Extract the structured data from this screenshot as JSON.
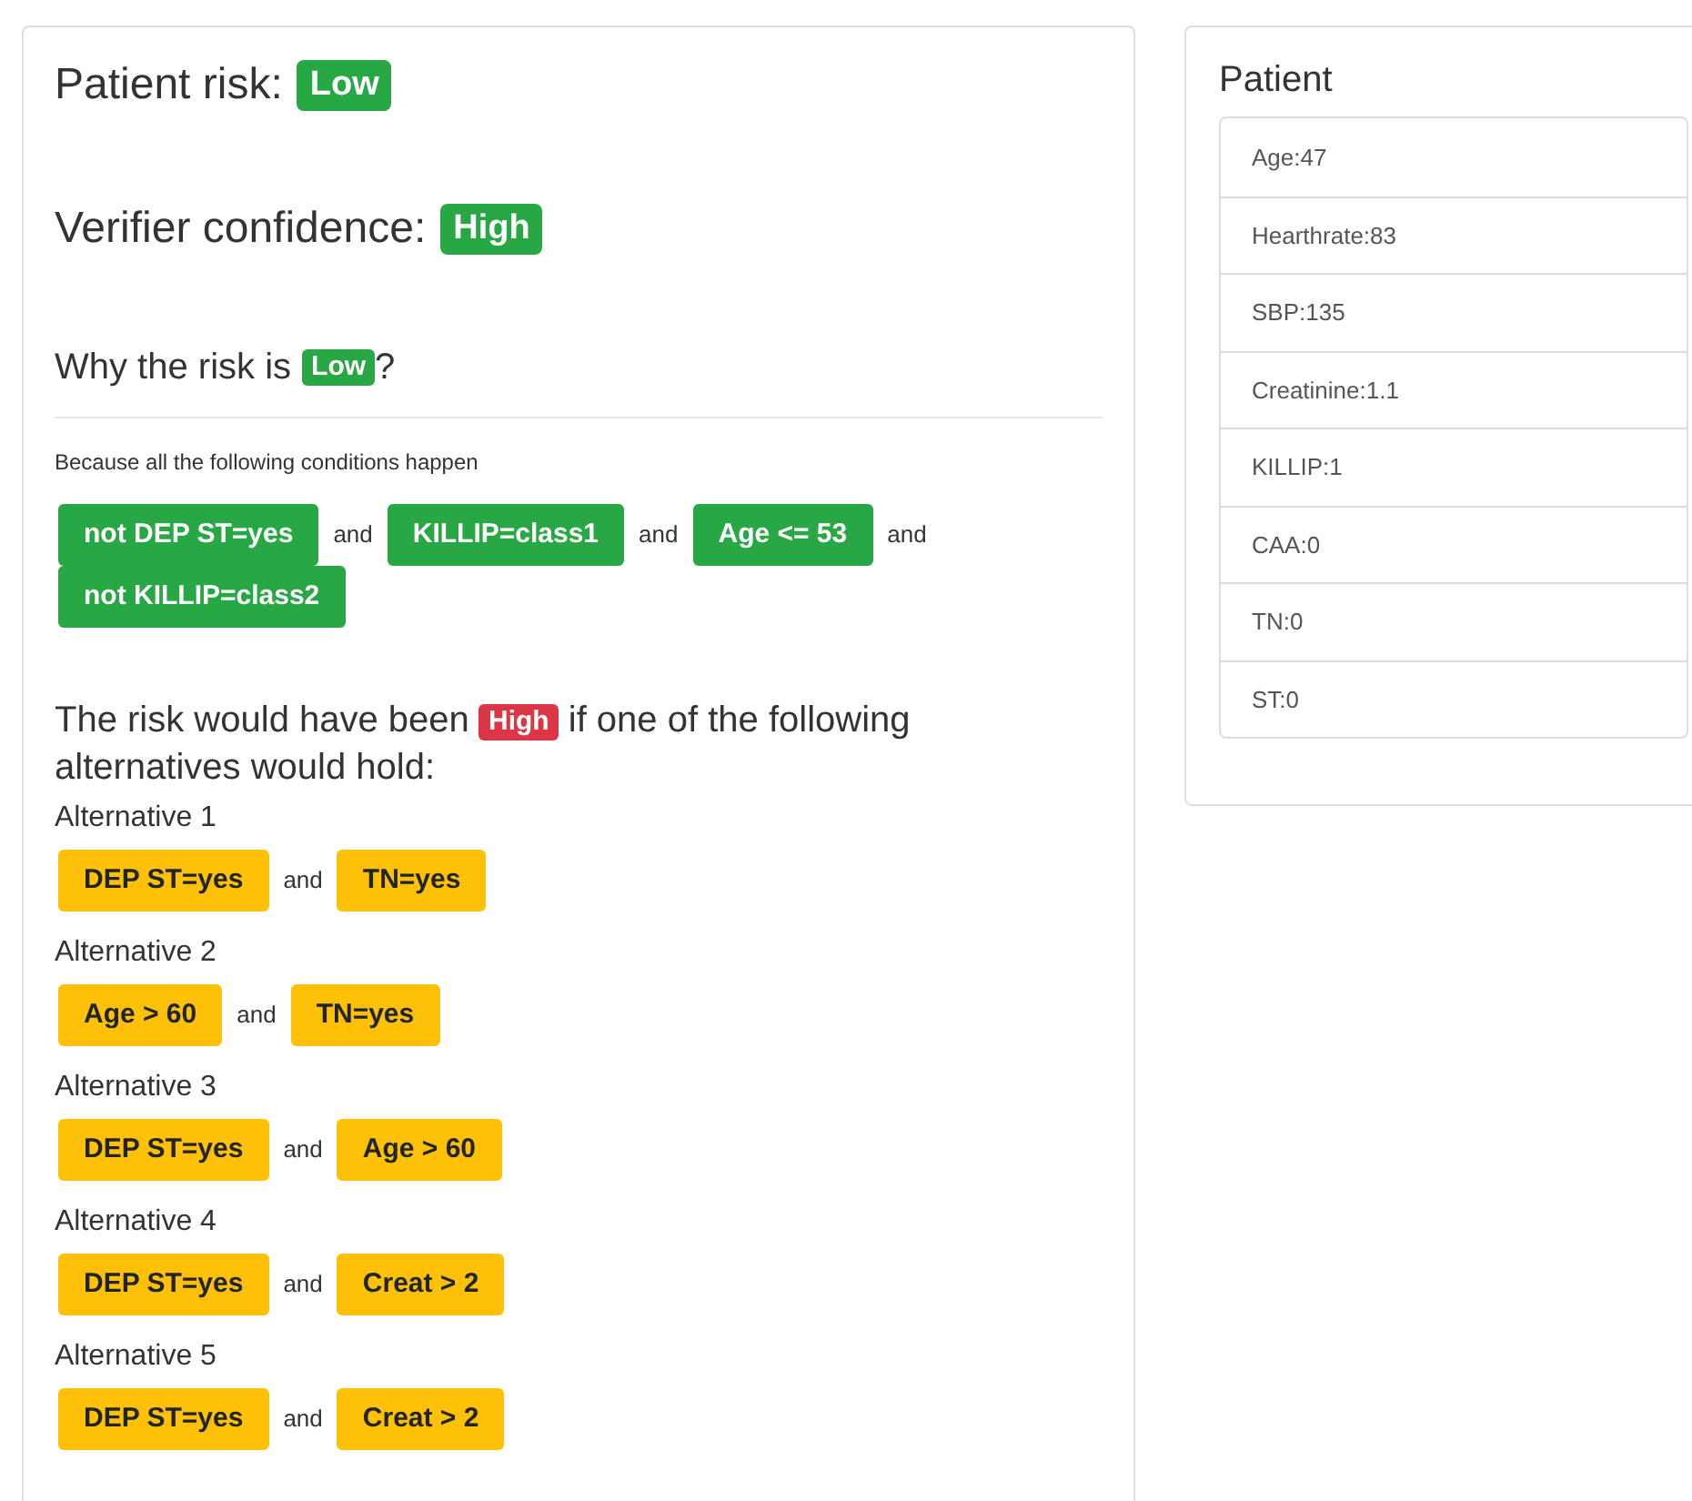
{
  "risk": {
    "label": "Patient risk:",
    "badge": {
      "text": "Low",
      "color": "#28a745"
    }
  },
  "confidence": {
    "label": "Verifier confidence:",
    "badge": {
      "text": "High",
      "color": "#28a745"
    }
  },
  "why": {
    "prefix": "Why the risk is",
    "badge": {
      "text": "Low",
      "color": "#28a745"
    },
    "suffix": "?"
  },
  "because": "Because all the following conditions happen",
  "conditions": [
    {
      "label": "not DEP ST=yes",
      "color": "#28a745",
      "joiner": "and"
    },
    {
      "label": "KILLIP=class1",
      "color": "#28a745",
      "joiner": "and"
    },
    {
      "label": "Age <= 53",
      "color": "#28a745",
      "joiner": "and"
    },
    {
      "label": "not KILLIP=class2",
      "color": "#28a745"
    }
  ],
  "counterfactual": {
    "prefix": "The risk would have been",
    "badge": {
      "text": "High",
      "color": "#dc3545"
    },
    "suffix": "if one of the following alternatives would hold:"
  },
  "alternatives": [
    {
      "title": "Alternative 1",
      "conditions": [
        {
          "label": "DEP ST=yes",
          "color": "#ffc107",
          "joiner": "and"
        },
        {
          "label": "TN=yes",
          "color": "#ffc107"
        }
      ]
    },
    {
      "title": "Alternative 2",
      "conditions": [
        {
          "label": "Age > 60",
          "color": "#ffc107",
          "joiner": "and"
        },
        {
          "label": "TN=yes",
          "color": "#ffc107"
        }
      ]
    },
    {
      "title": "Alternative 3",
      "conditions": [
        {
          "label": "DEP ST=yes",
          "color": "#ffc107",
          "joiner": "and"
        },
        {
          "label": "Age > 60",
          "color": "#ffc107"
        }
      ]
    },
    {
      "title": "Alternative 4",
      "conditions": [
        {
          "label": "DEP ST=yes",
          "color": "#ffc107",
          "joiner": "and"
        },
        {
          "label": "Creat > 2",
          "color": "#ffc107"
        }
      ]
    },
    {
      "title": "Alternative 5",
      "conditions": [
        {
          "label": "DEP ST=yes",
          "color": "#ffc107",
          "joiner": "and"
        },
        {
          "label": "Creat > 2",
          "color": "#ffc107"
        }
      ]
    }
  ],
  "patient": {
    "title": "Patient",
    "items": [
      "Age:47",
      "Hearthrate:83",
      "SBP:135",
      "Creatinine:1.1",
      "KILLIP:1",
      "CAA:0",
      "TN:0",
      "ST:0"
    ]
  }
}
